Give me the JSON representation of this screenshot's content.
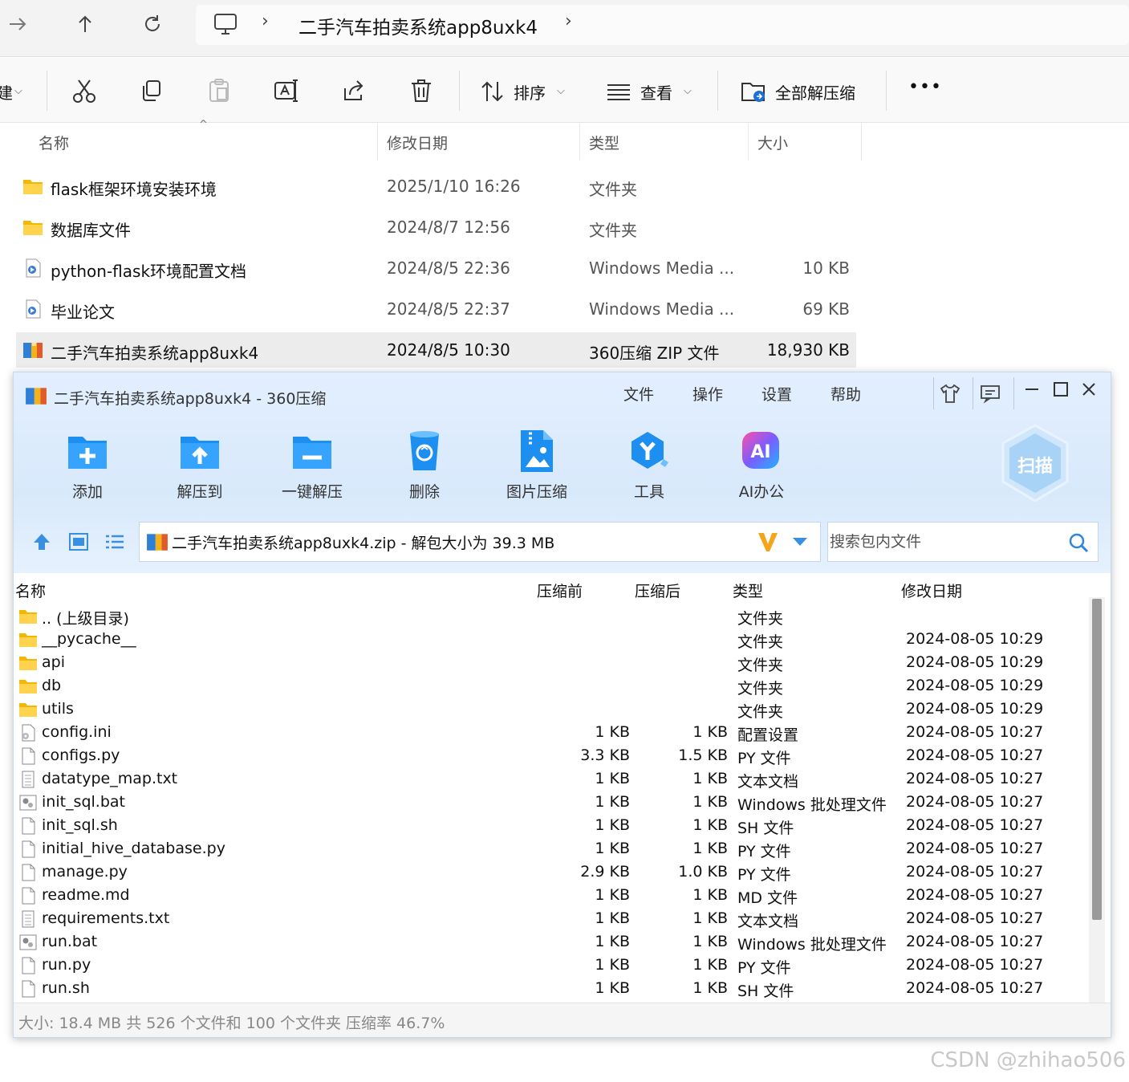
{
  "explorer": {
    "breadcrumb": {
      "title": "二手汽车拍卖系统app8uxk4",
      "sep": "›"
    },
    "command_bar": {
      "new_partial": "建",
      "sort_label": "排序",
      "view_label": "查看",
      "extract_all_label": "全部解压缩",
      "more_label": "•••"
    },
    "columns": {
      "name": "名称",
      "date": "修改日期",
      "type": "类型",
      "size": "大小"
    },
    "files": [
      {
        "name": "flask框架环境安装环境",
        "date": "2025/1/10 16:26",
        "type": "文件夹",
        "size": ""
      },
      {
        "name": "数据库文件",
        "date": "2024/8/7 12:56",
        "type": "文件夹",
        "size": ""
      },
      {
        "name": "python-flask环境配置文档",
        "date": "2024/8/5 22:36",
        "type": "Windows Media ...",
        "size": "10 KB"
      },
      {
        "name": "毕业论文",
        "date": "2024/8/5 22:37",
        "type": "Windows Media ...",
        "size": "69 KB"
      },
      {
        "name": "二手汽车拍卖系统app8uxk4",
        "date": "2024/8/5 10:30",
        "type": "360压缩 ZIP 文件",
        "size": "18,930 KB"
      }
    ]
  },
  "zip": {
    "title": "二手汽车拍卖系统app8uxk4 - 360压缩",
    "menu": [
      "文件",
      "操作",
      "设置",
      "帮助"
    ],
    "tools": [
      "添加",
      "解压到",
      "一键解压",
      "删除",
      "图片压缩",
      "工具",
      "AI办公"
    ],
    "scan_label": "扫描",
    "ai_badge": "AI",
    "path_text": "二手汽车拍卖系统app8uxk4.zip - 解包大小为 39.3 MB",
    "search_placeholder": "搜索包内文件",
    "columns": {
      "name": "名称",
      "before": "压缩前",
      "after": "压缩后",
      "type": "类型",
      "date": "修改日期"
    },
    "rows": [
      {
        "name": ".. (上级目录)",
        "before": "",
        "after": "",
        "type": "文件夹",
        "date": "",
        "kind": "folder"
      },
      {
        "name": "__pycache__",
        "before": "",
        "after": "",
        "type": "文件夹",
        "date": "2024-08-05 10:29",
        "kind": "folder"
      },
      {
        "name": "api",
        "before": "",
        "after": "",
        "type": "文件夹",
        "date": "2024-08-05 10:29",
        "kind": "folder"
      },
      {
        "name": "db",
        "before": "",
        "after": "",
        "type": "文件夹",
        "date": "2024-08-05 10:29",
        "kind": "folder"
      },
      {
        "name": "utils",
        "before": "",
        "after": "",
        "type": "文件夹",
        "date": "2024-08-05 10:29",
        "kind": "folder"
      },
      {
        "name": "config.ini",
        "before": "1 KB",
        "after": "1 KB",
        "type": "配置设置",
        "date": "2024-08-05 10:27",
        "kind": "settings"
      },
      {
        "name": "configs.py",
        "before": "3.3 KB",
        "after": "1.5 KB",
        "type": "PY 文件",
        "date": "2024-08-05 10:27",
        "kind": "file"
      },
      {
        "name": "datatype_map.txt",
        "before": "1 KB",
        "after": "1 KB",
        "type": "文本文档",
        "date": "2024-08-05 10:27",
        "kind": "text"
      },
      {
        "name": "init_sql.bat",
        "before": "1 KB",
        "after": "1 KB",
        "type": "Windows 批处理文件",
        "date": "2024-08-05 10:27",
        "kind": "bat"
      },
      {
        "name": "init_sql.sh",
        "before": "1 KB",
        "after": "1 KB",
        "type": "SH 文件",
        "date": "2024-08-05 10:27",
        "kind": "file"
      },
      {
        "name": "initial_hive_database.py",
        "before": "1 KB",
        "after": "1 KB",
        "type": "PY 文件",
        "date": "2024-08-05 10:27",
        "kind": "file"
      },
      {
        "name": "manage.py",
        "before": "2.9 KB",
        "after": "1.0 KB",
        "type": "PY 文件",
        "date": "2024-08-05 10:27",
        "kind": "file"
      },
      {
        "name": "readme.md",
        "before": "1 KB",
        "after": "1 KB",
        "type": "MD 文件",
        "date": "2024-08-05 10:27",
        "kind": "file"
      },
      {
        "name": "requirements.txt",
        "before": "1 KB",
        "after": "1 KB",
        "type": "文本文档",
        "date": "2024-08-05 10:27",
        "kind": "text"
      },
      {
        "name": "run.bat",
        "before": "1 KB",
        "after": "1 KB",
        "type": "Windows 批处理文件",
        "date": "2024-08-05 10:27",
        "kind": "bat"
      },
      {
        "name": "run.py",
        "before": "1 KB",
        "after": "1 KB",
        "type": "PY 文件",
        "date": "2024-08-05 10:27",
        "kind": "file"
      },
      {
        "name": "run.sh",
        "before": "1 KB",
        "after": "1 KB",
        "type": "SH 文件",
        "date": "2024-08-05 10:27",
        "kind": "file"
      }
    ],
    "status": "大小: 18.4 MB 共 526 个文件和 100 个文件夹 压缩率 46.7%"
  },
  "watermark": "CSDN @zhihao506",
  "colors": {
    "accent_blue": "#1e8be6",
    "folder_yellow": "#f7c948",
    "zip_header_bg": "#dbeafb"
  }
}
